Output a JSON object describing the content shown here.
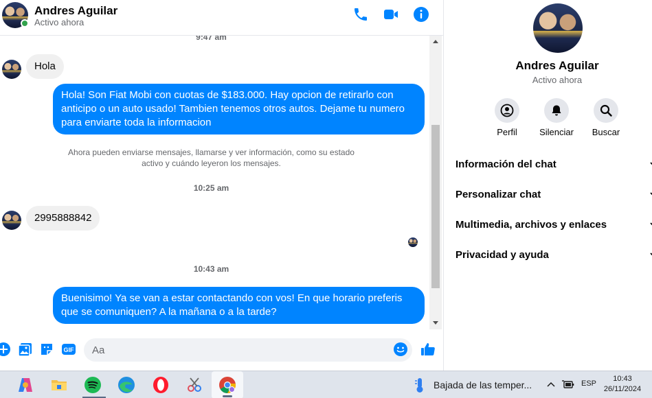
{
  "contact": {
    "name": "Andres Aguilar",
    "status": "Activo ahora"
  },
  "messages": [
    {
      "type": "time",
      "text": "9:47 am"
    },
    {
      "type": "incoming",
      "text": "Hola"
    },
    {
      "type": "outgoing",
      "text": "Hola! Son Fiat Mobi con cuotas de $183.000. Hay opcion de retirarlo con anticipo o un auto usado! Tambien tenemos otros autos. Dejame tu numero para enviarte toda la informacion"
    },
    {
      "type": "info",
      "line1": "Ahora pueden enviarse mensajes, llamarse y ver información, como su estado",
      "line2": "activo y cuándo leyeron los mensajes."
    },
    {
      "type": "time",
      "text": "10:25 am"
    },
    {
      "type": "incoming",
      "text": "2995888842"
    },
    {
      "type": "time",
      "text": "10:43 am"
    },
    {
      "type": "outgoing",
      "text": "Buenisimo! Ya se van a estar contactando con vos! En que horario preferis que se comuniquen? A la mañana o a la tarde?"
    }
  ],
  "composer": {
    "placeholder": "Aa"
  },
  "panel": {
    "buttons": [
      {
        "label": "Perfil",
        "icon": "profile-icon"
      },
      {
        "label": "Silenciar",
        "icon": "bell-icon"
      },
      {
        "label": "Buscar",
        "icon": "search-icon"
      }
    ],
    "sections": [
      "Información del chat",
      "Personalizar chat",
      "Multimedia, archivos y enlaces",
      "Privacidad y ayuda"
    ]
  },
  "taskbar": {
    "weather": "Bajada de las temper...",
    "language": "ESP",
    "time": "10:43",
    "date": "26/11/2024"
  },
  "colors": {
    "accent": "#0084ff",
    "online": "#31a24c",
    "bubble_in": "#f0f0f0"
  }
}
